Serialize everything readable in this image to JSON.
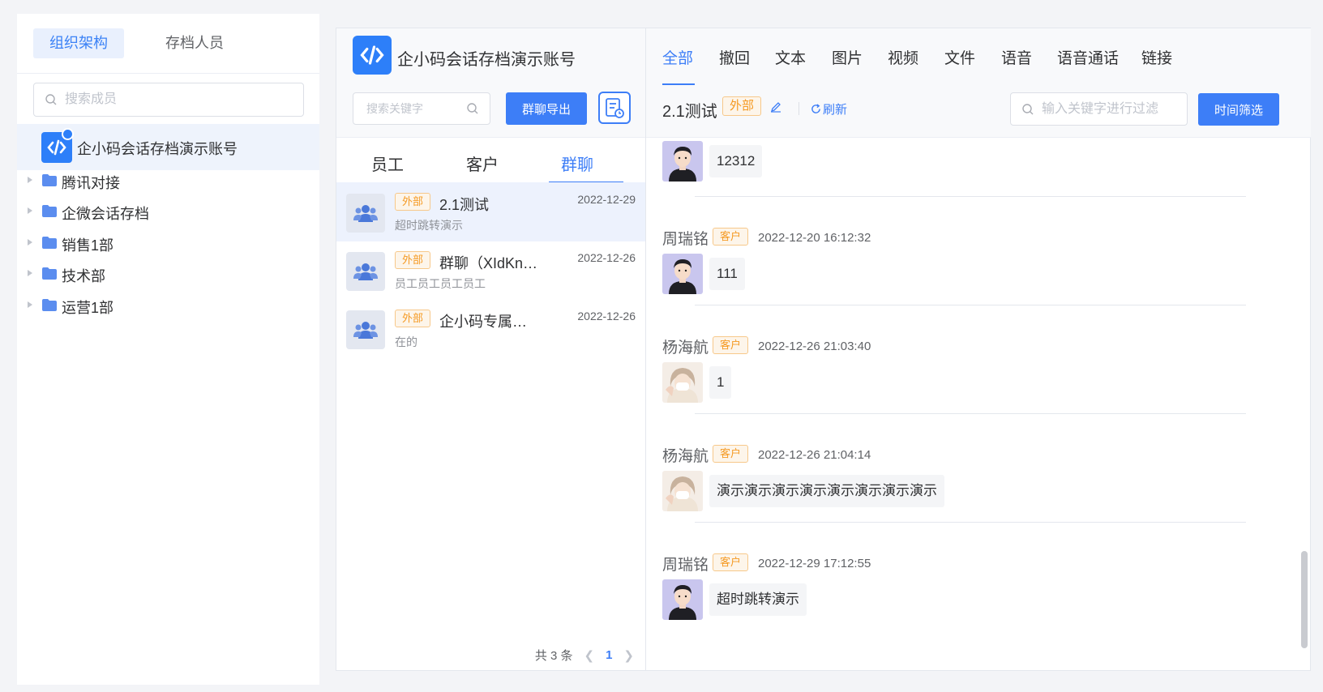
{
  "left_panel": {
    "tabs": [
      "组织架构",
      "存档人员"
    ],
    "search_placeholder": "搜索成员",
    "account_name": "企小码会话存档演示账号",
    "tree": [
      "腾讯对接",
      "企微会话存档",
      "销售1部",
      "技术部",
      "运营1部"
    ]
  },
  "middle_panel": {
    "account_name": "企小码会话存档演示账号",
    "search_placeholder": "搜索关键字",
    "export_button": "群聊导出",
    "tabs": [
      "员工",
      "客户",
      "群聊"
    ],
    "active_tab": "群聊",
    "groups": [
      {
        "tag": "外部",
        "name": "2.1测试",
        "date": "2022-12-29",
        "last_msg": "超时跳转演示"
      },
      {
        "tag": "外部",
        "name": "群聊（XIdKnA）",
        "date": "2022-12-26",
        "last_msg": "员工员工员工员工"
      },
      {
        "tag": "外部",
        "name": "企小码专属外…",
        "date": "2022-12-26",
        "last_msg": "在的"
      }
    ],
    "pager": {
      "total": "共 3 条",
      "current": "1"
    }
  },
  "right_panel": {
    "filter_tabs": [
      "全部",
      "撤回",
      "文本",
      "图片",
      "视频",
      "文件",
      "语音",
      "语音通话",
      "链接"
    ],
    "active_filter": "全部",
    "chat_title": "2.1测试",
    "chat_tag": "外部",
    "refresh_label": "刷新",
    "filter_placeholder": "输入关键字进行过滤",
    "time_filter_button": "时间筛选",
    "messages": [
      {
        "sender": "",
        "tag": "",
        "time": "",
        "text": "12312",
        "avatar": "male"
      },
      {
        "sender": "周瑞铭",
        "tag": "客户",
        "time": "2022-12-20 16:12:32",
        "text": "111",
        "avatar": "male"
      },
      {
        "sender": "杨海航",
        "tag": "客户",
        "time": "2022-12-26 21:03:40",
        "text": "1",
        "avatar": "female"
      },
      {
        "sender": "杨海航",
        "tag": "客户",
        "time": "2022-12-26 21:04:14",
        "text": "演示演示演示演示演示演示演示演示",
        "avatar": "female"
      },
      {
        "sender": "周瑞铭",
        "tag": "客户",
        "time": "2022-12-29 17:12:55",
        "text": "超时跳转演示",
        "avatar": "male"
      }
    ]
  },
  "colors": {
    "accent": "#3d7ef7",
    "tag_orange": "#f59a23",
    "selected_bg": "#edf2fd"
  },
  "icons": [
    "search-icon",
    "logo-icon",
    "verified-badge-icon",
    "folder-icon",
    "group-icon",
    "export-history-icon",
    "pencil-icon",
    "refresh-icon",
    "chevron-left-icon",
    "chevron-right-icon"
  ]
}
